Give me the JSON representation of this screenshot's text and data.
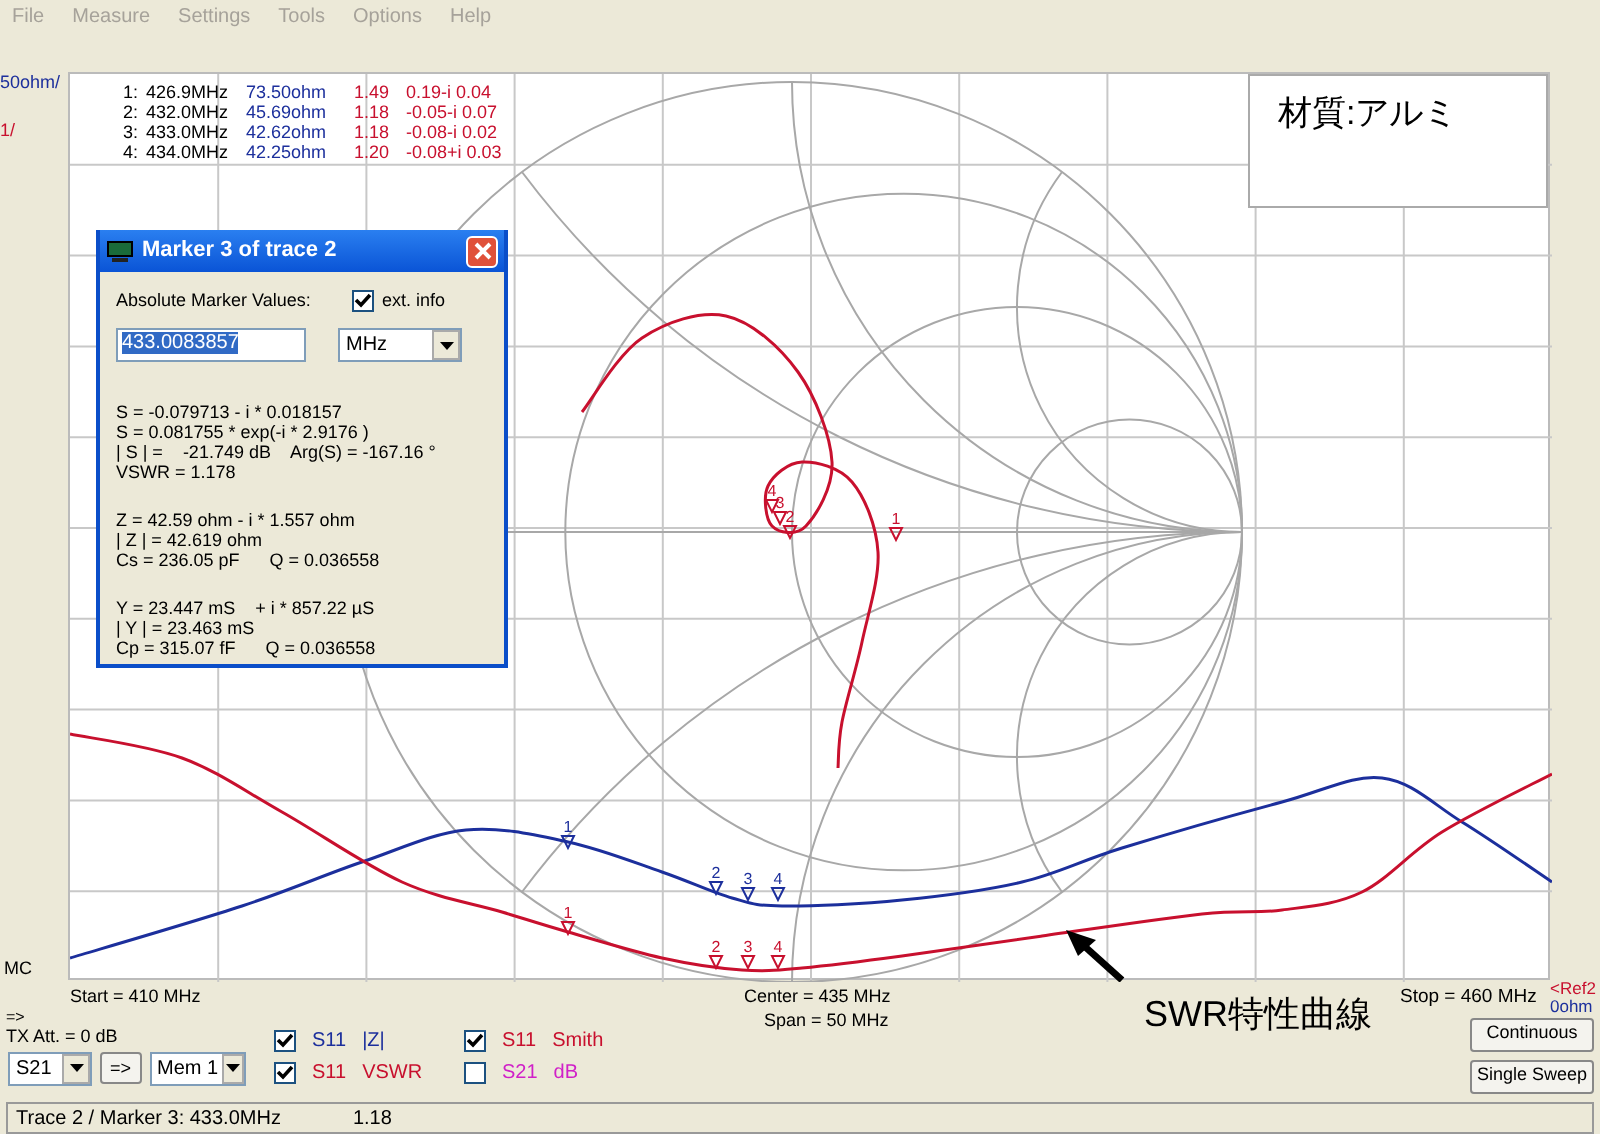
{
  "menu": [
    {
      "label": "File",
      "disabled": true
    },
    {
      "label": "Measure",
      "disabled": true
    },
    {
      "label": "Settings",
      "disabled": true
    },
    {
      "label": "Tools",
      "disabled": true
    },
    {
      "label": "Options",
      "disabled": true
    },
    {
      "label": "Help",
      "disabled": true
    }
  ],
  "scale_labels": {
    "z_scale": "50ohm/",
    "vswr_scale": "1/",
    "mode": "MC",
    "ref": "<Ref2",
    "ref_value": "0ohm"
  },
  "marker_table": [
    {
      "index": "1:",
      "frequency": "426.9MHz",
      "impedance": "73.50ohm",
      "vswr": "1.49",
      "reflection": "0.19-i 0.04"
    },
    {
      "index": "2:",
      "frequency": "432.0MHz",
      "impedance": "45.69ohm",
      "vswr": "1.18",
      "reflection": "-0.05-i 0.07"
    },
    {
      "index": "3:",
      "frequency": "433.0MHz",
      "impedance": "42.62ohm",
      "vswr": "1.18",
      "reflection": "-0.08-i 0.02"
    },
    {
      "index": "4:",
      "frequency": "434.0MHz",
      "impedance": "42.25ohm",
      "vswr": "1.20",
      "reflection": "-0.08+i 0.03"
    }
  ],
  "annotation_box": {
    "text": "材質:アルミ"
  },
  "traces": [
    {
      "kind": "smith",
      "color": "#c8102e",
      "markers": [
        "1",
        "2",
        "3",
        "4"
      ]
    },
    {
      "kind": "magnitude",
      "color": "#1c2f9c",
      "markers": [
        "1",
        "2",
        "3",
        "4"
      ]
    },
    {
      "kind": "vswr",
      "color": "#c8102e",
      "markers": [
        "1",
        "2",
        "3",
        "4"
      ]
    }
  ],
  "marker_dialog": {
    "title": "Marker 3 of trace 2",
    "heading": "Absolute Marker Values:",
    "ext_info": {
      "label": "ext. info",
      "checked": true
    },
    "frequency": "433.0083857",
    "unit": "MHz",
    "groups": [
      [
        "S = -0.079713 - i * 0.018157",
        "S = 0.081755 * exp(-i * 2.9176 )",
        "| S | =    -21.749 dB    Arg(S) = -167.16 °",
        "VSWR = 1.178"
      ],
      [
        "Z = 42.59 ohm - i * 1.557 ohm",
        "| Z | = 42.619 ohm",
        "Cs = 236.05 pF      Q = 0.036558"
      ],
      [
        "Y = 23.447 mS    + i * 857.22 µS",
        "| Y | = 23.463 mS",
        "Cp = 315.07 fF      Q = 0.036558"
      ]
    ]
  },
  "sweep": {
    "start": "Start = 410 MHz",
    "center": "Center = 435 MHz",
    "span": "Span = 50 MHz",
    "stop": "Stop = 460 MHz"
  },
  "callout": "SWR特性曲線",
  "controls": {
    "arrow_label": "=>",
    "tx_attenuation": "TX Att.  = 0 dB",
    "source_select": "S21",
    "copy_button": "=>",
    "memory_select": "Mem 1",
    "trace_toggles": [
      {
        "parameter": "S11",
        "format": "|Z|",
        "checked": true,
        "color": "#1c2f9c"
      },
      {
        "parameter": "S11",
        "format": "Smith",
        "checked": true,
        "color": "#c8102e"
      },
      {
        "parameter": "S11",
        "format": "VSWR",
        "checked": true,
        "color": "#c8102e"
      },
      {
        "parameter": "S21",
        "format": "dB",
        "checked": false,
        "color": "#d020c8"
      }
    ],
    "buttons": [
      "Continuous",
      "Single Sweep"
    ]
  },
  "status_bar": {
    "trace_marker": "Trace 2 / Marker 3:  433.0MHz",
    "value": "1.18"
  }
}
